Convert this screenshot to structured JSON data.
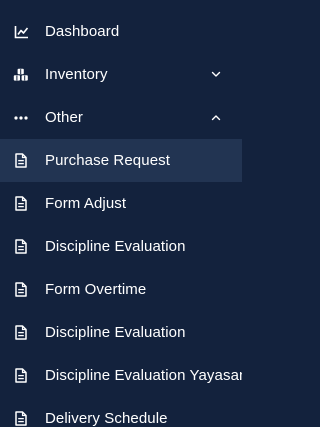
{
  "sidebar": {
    "items": [
      {
        "label": "Dashboard",
        "icon": "chart-line-icon"
      },
      {
        "label": "Inventory",
        "icon": "cubes-icon",
        "chevron": "chevron-down-icon"
      },
      {
        "label": "Other",
        "icon": "ellipsis-icon",
        "chevron": "chevron-up-icon"
      },
      {
        "label": "Purchase Request",
        "icon": "document-icon"
      },
      {
        "label": "Form Adjust",
        "icon": "document-icon"
      },
      {
        "label": "Discipline Evaluation",
        "icon": "document-icon"
      },
      {
        "label": "Form Overtime",
        "icon": "document-icon"
      },
      {
        "label": "Discipline Evaluation",
        "icon": "document-icon"
      },
      {
        "label": "Discipline Evaluation Yayasan",
        "icon": "document-icon"
      },
      {
        "label": "Delivery Schedule",
        "icon": "document-icon"
      }
    ],
    "active_index": 3
  },
  "colors": {
    "background": "#13223d",
    "active_background": "#223452",
    "text": "#ffffff"
  }
}
